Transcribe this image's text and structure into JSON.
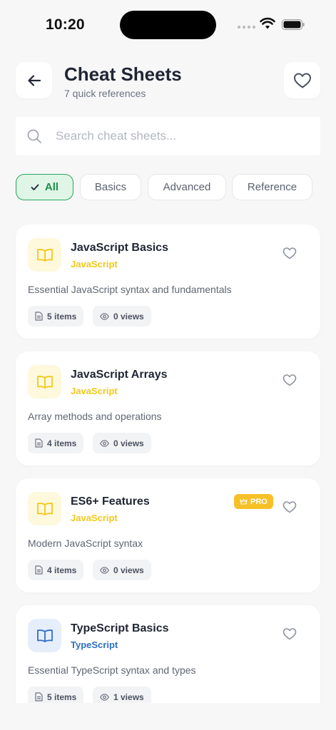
{
  "status_bar": {
    "time": "10:20"
  },
  "header": {
    "title": "Cheat Sheets",
    "subtitle": "7 quick references"
  },
  "search": {
    "placeholder": "Search cheat sheets..."
  },
  "filters": [
    {
      "label": "All",
      "active": true
    },
    {
      "label": "Basics",
      "active": false
    },
    {
      "label": "Advanced",
      "active": false
    },
    {
      "label": "Reference",
      "active": false
    }
  ],
  "cards": [
    {
      "title": "JavaScript Basics",
      "language": "JavaScript",
      "language_color": "#f2c81b",
      "icon_bg": "#fef8dc",
      "description": "Essential JavaScript syntax and fundamentals",
      "items": "5 items",
      "views": "0 views",
      "pro": false
    },
    {
      "title": "JavaScript Arrays",
      "language": "JavaScript",
      "language_color": "#f2c81b",
      "icon_bg": "#fef8dc",
      "description": "Array methods and operations",
      "items": "4 items",
      "views": "0 views",
      "pro": false
    },
    {
      "title": "ES6+ Features",
      "language": "JavaScript",
      "language_color": "#f2c81b",
      "icon_bg": "#fef8dc",
      "description": "Modern JavaScript syntax",
      "items": "4 items",
      "views": "0 views",
      "pro": true,
      "pro_label": "PRO"
    },
    {
      "title": "TypeScript Basics",
      "language": "TypeScript",
      "language_color": "#2f6fc4",
      "icon_bg": "#e6eefb",
      "description": "Essential TypeScript syntax and types",
      "items": "5 items",
      "views": "1 views",
      "pro": false
    }
  ],
  "colors": {
    "accent_green": "#2aa65a",
    "pro_badge": "#f6c026",
    "background": "#f7f7f8"
  }
}
